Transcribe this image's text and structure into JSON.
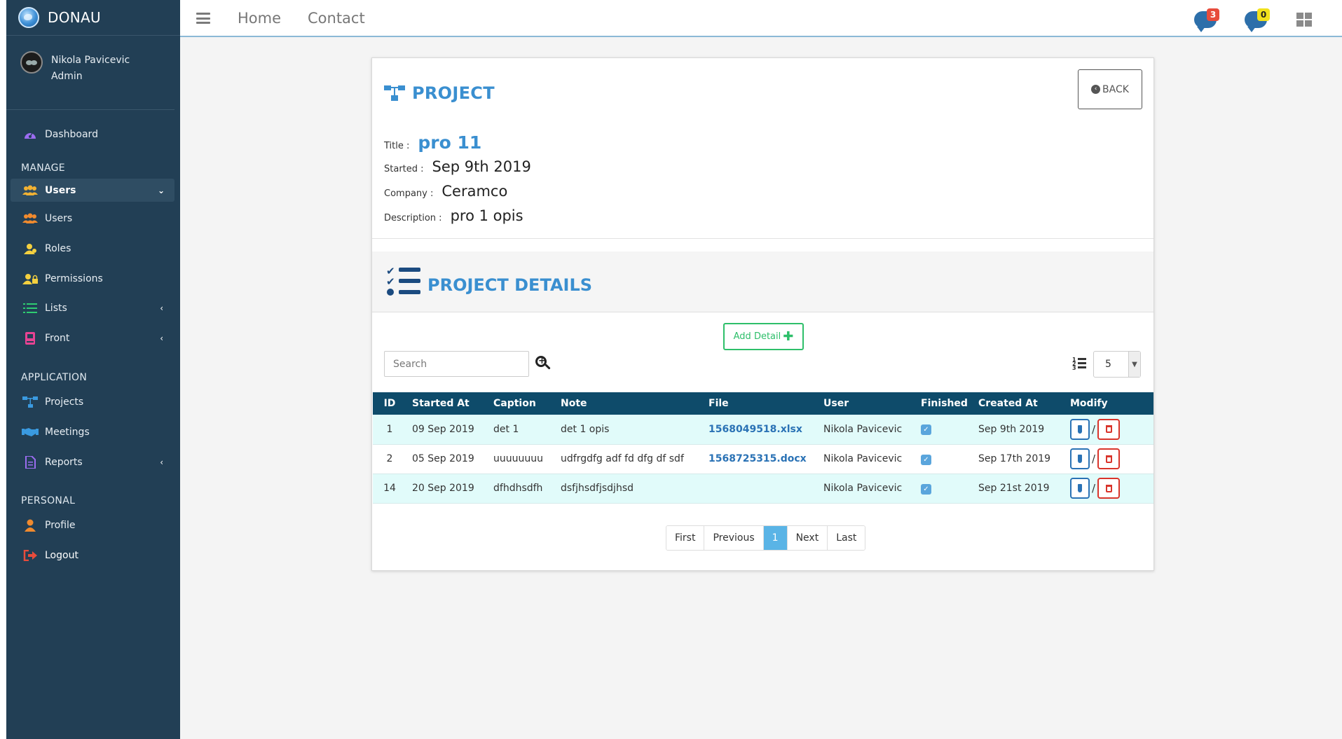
{
  "brand": {
    "name": "DONAU"
  },
  "user": {
    "name": "Nikola Pavicevic",
    "role": "Admin"
  },
  "sidebar": {
    "dashboard": "Dashboard",
    "manage_heading": "MANAGE",
    "manage": [
      {
        "label": "Users",
        "icon": "users-icon",
        "active": true,
        "chevron": "⌄"
      },
      {
        "label": "Users",
        "icon": "users-icon"
      },
      {
        "label": "Roles",
        "icon": "user-icon"
      },
      {
        "label": "Permissions",
        "icon": "user-lock-icon"
      },
      {
        "label": "Lists",
        "icon": "list-icon",
        "chevron": "‹"
      },
      {
        "label": "Front",
        "icon": "book-icon",
        "chevron": "‹"
      }
    ],
    "application_heading": "APPLICATION",
    "application": [
      {
        "label": "Projects",
        "icon": "sitemap-icon"
      },
      {
        "label": "Meetings",
        "icon": "handshake-icon"
      },
      {
        "label": "Reports",
        "icon": "file-icon",
        "chevron": "‹"
      }
    ],
    "personal_heading": "PERSONAL",
    "personal": [
      {
        "label": "Profile",
        "icon": "user-icon"
      },
      {
        "label": "Logout",
        "icon": "sign-out-icon"
      }
    ]
  },
  "topbar": {
    "home": "Home",
    "contact": "Contact",
    "messages_count": "3",
    "notifications_count": "0"
  },
  "project": {
    "heading": "PROJECT",
    "back_label": "BACK",
    "title_label": "Title :",
    "title": "pro 11",
    "started_label": "Started :",
    "started": "Sep 9th 2019",
    "company_label": "Company :",
    "company": "Ceramco",
    "description_label": "Description :",
    "description": "pro 1 opis"
  },
  "details": {
    "heading": "PROJECT DETAILS",
    "add_label": "Add Detail",
    "search_placeholder": "Search",
    "page_size": "5",
    "columns": [
      "ID",
      "Started At",
      "Caption",
      "Note",
      "File",
      "User",
      "Finished",
      "Created At",
      "Modify"
    ],
    "rows": [
      {
        "id": "1",
        "started": "09 Sep 2019",
        "caption": "det 1",
        "note": "det 1 opis",
        "file": "1568049518.xlsx",
        "user": "Nikola Pavicevic",
        "finished": true,
        "created": "Sep 9th 2019"
      },
      {
        "id": "2",
        "started": "05 Sep 2019",
        "caption": "uuuuuuuu",
        "note": "udfrgdfg adf fd dfg df sdf",
        "file": "1568725315.docx",
        "user": "Nikola Pavicevic",
        "finished": true,
        "created": "Sep 17th 2019"
      },
      {
        "id": "14",
        "started": "20 Sep 2019",
        "caption": "dfhdhsdfh",
        "note": "dsfjhsdfjsdjhsd",
        "file": "",
        "user": "Nikola Pavicevic",
        "finished": true,
        "created": "Sep 21st 2019"
      }
    ],
    "pager": {
      "first": "First",
      "previous": "Previous",
      "current": "1",
      "next": "Next",
      "last": "Last"
    }
  }
}
